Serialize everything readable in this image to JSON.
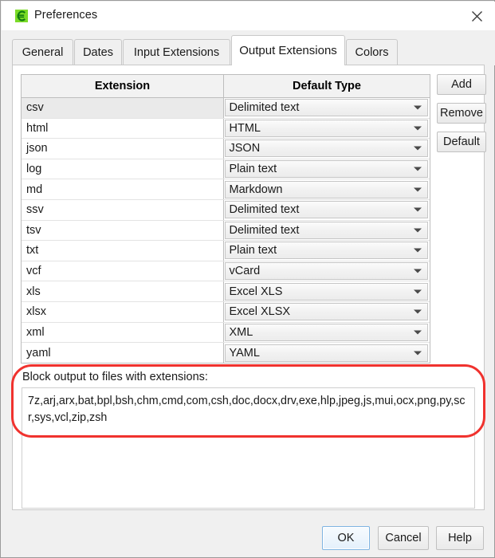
{
  "window": {
    "title": "Preferences",
    "app_icon": "euro-sign-icon",
    "close_icon": "close-icon",
    "accent_color": "#7bdb28",
    "annotation_color": "#f0322e",
    "focus_color": "#7eb4e2"
  },
  "tabs": [
    {
      "label": "General",
      "active": false
    },
    {
      "label": "Dates",
      "active": false
    },
    {
      "label": "Input Extensions",
      "active": false
    },
    {
      "label": "Output Extensions",
      "active": true
    },
    {
      "label": "Colors",
      "active": false
    }
  ],
  "grid": {
    "columns": [
      "Extension",
      "Default Type"
    ],
    "rows": [
      {
        "extension": "csv",
        "type": "Delimited text",
        "selected": true
      },
      {
        "extension": "html",
        "type": "HTML",
        "selected": false
      },
      {
        "extension": "json",
        "type": "JSON",
        "selected": false
      },
      {
        "extension": "log",
        "type": "Plain text",
        "selected": false
      },
      {
        "extension": "md",
        "type": "Markdown",
        "selected": false
      },
      {
        "extension": "ssv",
        "type": "Delimited text",
        "selected": false
      },
      {
        "extension": "tsv",
        "type": "Delimited text",
        "selected": false
      },
      {
        "extension": "txt",
        "type": "Plain text",
        "selected": false
      },
      {
        "extension": "vcf",
        "type": "vCard",
        "selected": false
      },
      {
        "extension": "xls",
        "type": "Excel XLS",
        "selected": false
      },
      {
        "extension": "xlsx",
        "type": "Excel XLSX",
        "selected": false
      },
      {
        "extension": "xml",
        "type": "XML",
        "selected": false
      },
      {
        "extension": "yaml",
        "type": "YAML",
        "selected": false
      }
    ]
  },
  "side_buttons": [
    {
      "label": "Add"
    },
    {
      "label": "Remove"
    },
    {
      "label": "Default"
    }
  ],
  "block_output": {
    "label": "Block output to files with extensions:",
    "value": "7z,arj,arx,bat,bpl,bsh,chm,cmd,com,csh,doc,docx,drv,exe,hlp,jpeg,js,mui,ocx,png,py,scr,sys,vcl,zip,zsh"
  },
  "bottom_buttons": {
    "ok": "OK",
    "cancel": "Cancel",
    "help": "Help"
  }
}
